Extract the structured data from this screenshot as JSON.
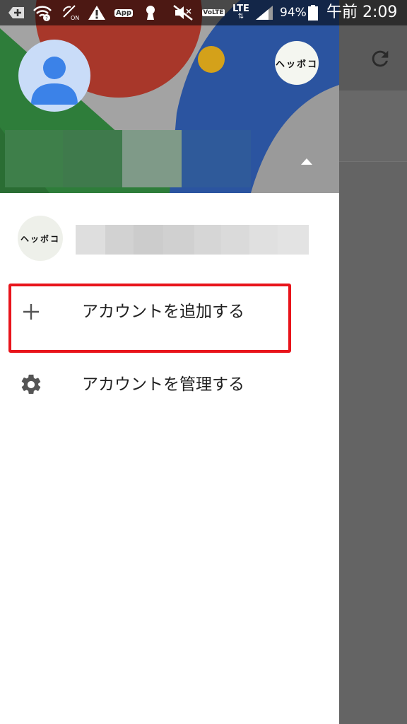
{
  "status_bar": {
    "battery_percent": "94%",
    "network": "LTE",
    "volte": "VoLTE",
    "app_badge": "App",
    "clock": "午前 2:09"
  },
  "drawer": {
    "secondary_account_avatar_text": "ヘッボコ",
    "account_list": [
      {
        "avatar_text": "ヘッボコ"
      }
    ],
    "menu": {
      "add_account": "アカウントを追加する",
      "manage_accounts": "アカウントを管理する"
    }
  },
  "colors": {
    "highlight_border": "#e8141b",
    "header_red": "#a8372a",
    "header_green": "#2e7d3a",
    "header_blue": "#2b54a0",
    "header_yellow": "#d4a11a"
  },
  "icons": {
    "add_account": "plus-icon",
    "manage_accounts": "gear-icon",
    "header_toggle": "arrow-up-icon",
    "toolbar": "refresh-icon"
  }
}
